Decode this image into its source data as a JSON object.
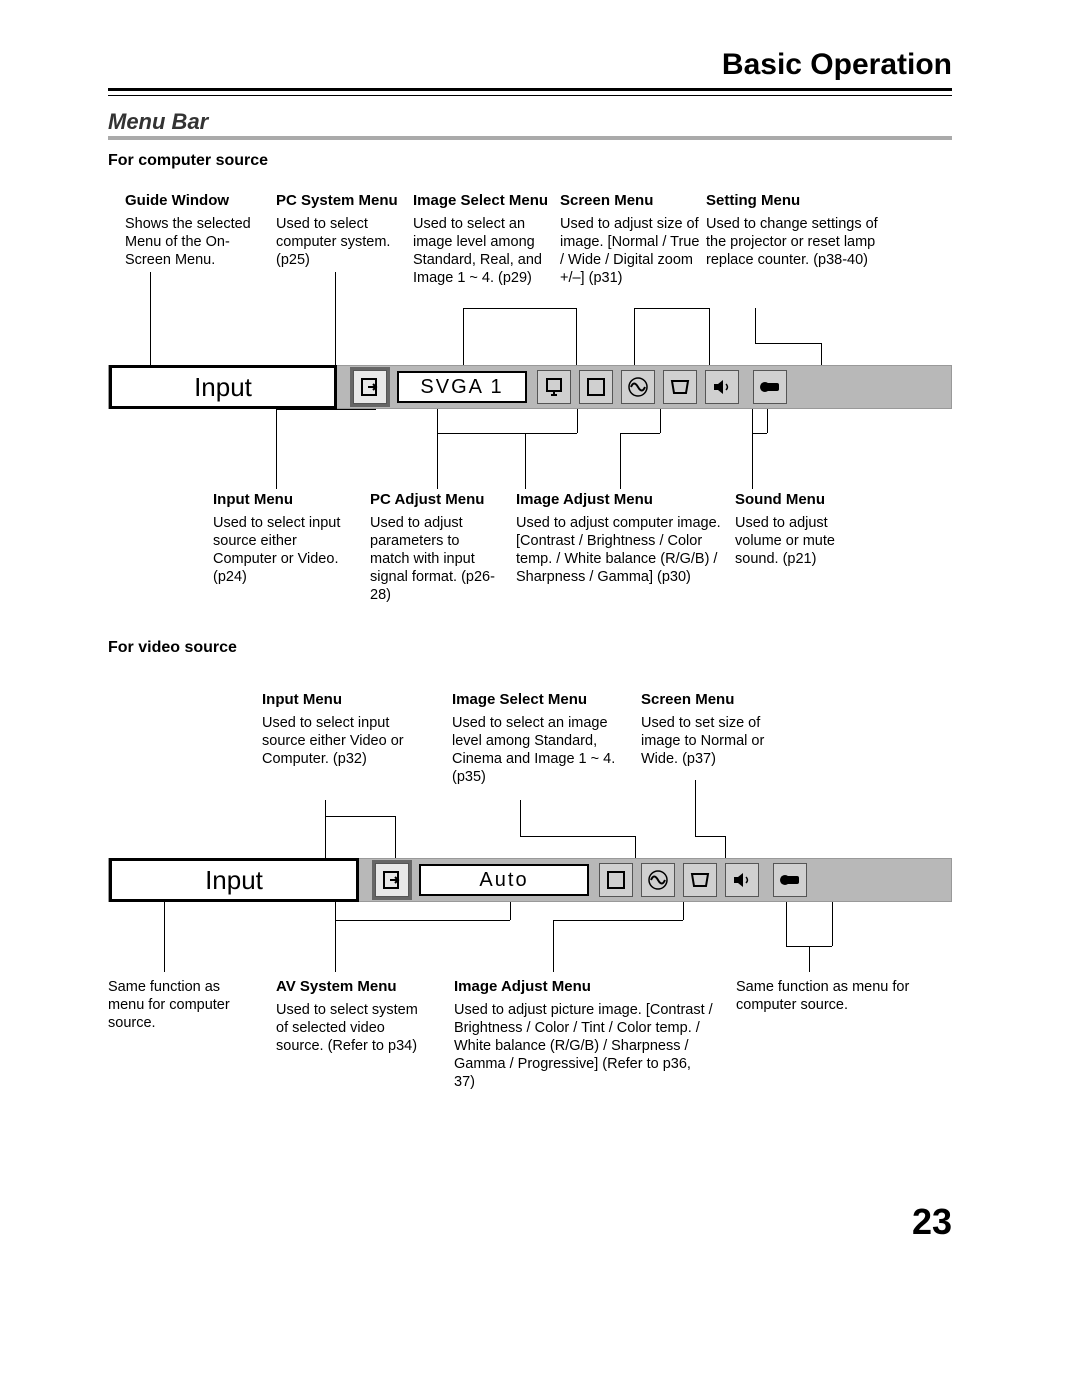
{
  "header": "Basic Operation",
  "section": "Menu Bar",
  "sub1": "For computer source",
  "sub2": "For video source",
  "pageNum": "23",
  "bar1": {
    "input": "Input",
    "mode": "SVGA 1"
  },
  "bar2": {
    "input": "Input",
    "mode": "Auto"
  },
  "c": {
    "guideWindow": {
      "t": "Guide Window",
      "d": "Shows the selected Menu of the On-Screen Menu."
    },
    "pcSystem": {
      "t": "PC System Menu",
      "d": "Used to select computer system. (p25)"
    },
    "imageSelect": {
      "t": "Image Select Menu",
      "d": "Used to select  an image level among Standard, Real, and Image 1 ~ 4. (p29)"
    },
    "screen": {
      "t": "Screen Menu",
      "d": "Used to adjust size of image.  [Normal / True / Wide / Digital zoom +/–] (p31)"
    },
    "setting": {
      "t": "Setting Menu",
      "d": "Used to change settings of the projector or reset  lamp replace counter. (p38-40)"
    },
    "inputMenu": {
      "t": "Input Menu",
      "d": "Used to select input source either Computer or Video.  (p24)"
    },
    "pcAdjust": {
      "t": "PC Adjust Menu",
      "d": "Used to adjust parameters to match with input signal format. (p26-28)"
    },
    "imageAdjust": {
      "t": "Image Adjust Menu",
      "d": "Used to adjust computer image. [Contrast / Brightness / Color temp. /  White balance (R/G/B) / Sharpness /  Gamma]   (p30)"
    },
    "sound": {
      "t": "Sound Menu",
      "d": "Used to adjust volume or mute sound.  (p21)"
    }
  },
  "v": {
    "inputMenu2": {
      "t": "Input Menu",
      "d": "Used to select input source either Video or Computer. (p32)"
    },
    "imageSelect2": {
      "t": "Image Select Menu",
      "d": "Used to select an image level among Standard, Cinema and Image 1 ~ 4. (p35)"
    },
    "screen2": {
      "t": "Screen Menu",
      "d": "Used to set size of image to Normal or Wide. (p37)"
    },
    "sameLeft": {
      "d": "Same function as menu for computer source."
    },
    "avSystem": {
      "t": "AV System Menu",
      "d": "Used to select system of selected video source. (Refer to p34)"
    },
    "imageAdjust2": {
      "t": "Image Adjust Menu",
      "d": "Used to adjust picture image. [Contrast / Brightness / Color / Tint / Color temp. / White balance (R/G/B) / Sharpness /  Gamma / Progressive] (Refer to p36, 37)"
    },
    "sameRight": {
      "d": "Same function as menu for computer source."
    }
  }
}
